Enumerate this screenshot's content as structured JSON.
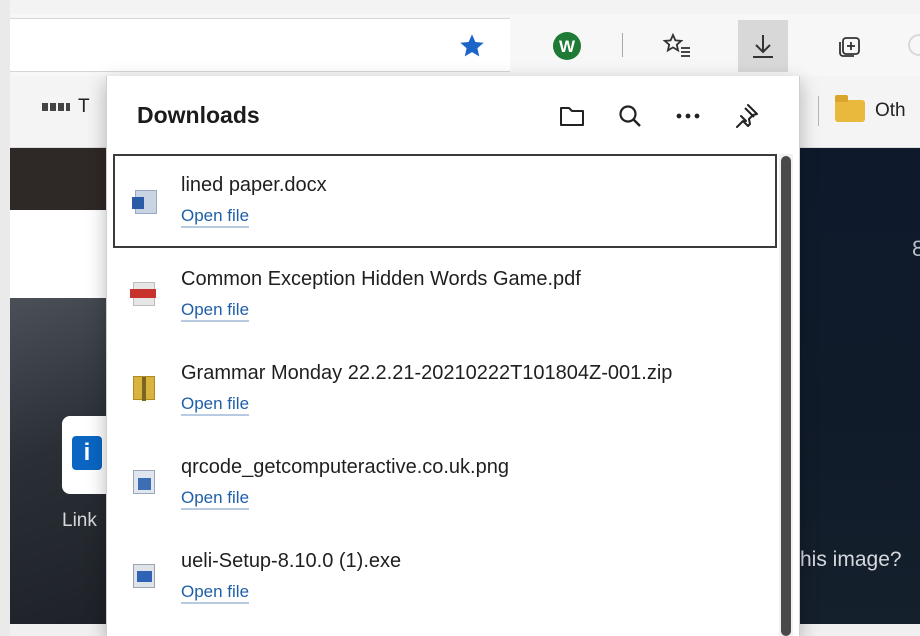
{
  "toolbar": {
    "icons": [
      "star-icon",
      "w-extension-icon",
      "favorites-icon",
      "download-icon",
      "collections-icon"
    ],
    "star_color": "#1c64c7",
    "extension_color": "#1e7a34",
    "extension_letter": "W"
  },
  "favbar": {
    "left_item_label": "T",
    "right_item_label": "Oth"
  },
  "page": {
    "tile_label": "Link",
    "right_number": "8",
    "right_caption": "his image?"
  },
  "downloads": {
    "title": "Downloads",
    "action_icons": [
      "open-folder-icon",
      "search-icon",
      "more-options-icon",
      "pin-icon"
    ],
    "items": [
      {
        "name": "lined paper.docx",
        "action": "Open file",
        "icon": "docx-file-icon",
        "selected": true
      },
      {
        "name": "Common Exception Hidden Words Game.pdf",
        "action": "Open file",
        "icon": "pdf-file-icon",
        "selected": false
      },
      {
        "name": "Grammar Monday 22.2.21-20210222T101804Z-001.zip",
        "action": "Open file",
        "icon": "zip-file-icon",
        "selected": false
      },
      {
        "name": "qrcode_getcomputeractive.co.uk.png",
        "action": "Open file",
        "icon": "png-file-icon",
        "selected": false
      },
      {
        "name": "ueli-Setup-8.10.0 (1).exe",
        "action": "Open file",
        "icon": "exe-file-icon",
        "selected": false
      }
    ]
  }
}
